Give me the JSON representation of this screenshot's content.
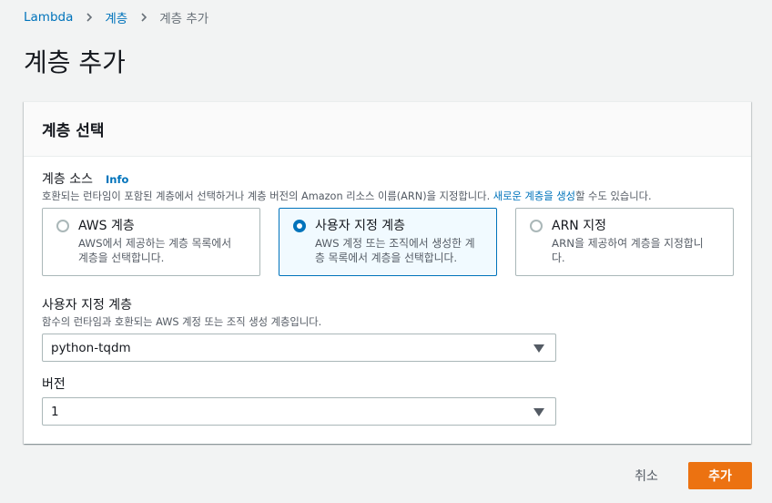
{
  "breadcrumb": {
    "items": [
      "Lambda",
      "계층",
      "계층 추가"
    ]
  },
  "page": {
    "title": "계층 추가"
  },
  "panel": {
    "title": "계층 선택",
    "source": {
      "label": "계층 소스",
      "info": "Info",
      "description_prefix": "호환되는 런타임이 포함된 계층에서 선택하거나 계층 버전의 Amazon 리소스 이름(ARN)을 지정합니다. ",
      "description_link": "새로운 계층을 생성",
      "description_suffix": "할 수도 있습니다.",
      "options": [
        {
          "title": "AWS 계층",
          "description": "AWS에서 제공하는 계층 목록에서 계층을 선택합니다.",
          "selected": false
        },
        {
          "title": "사용자 지정 계층",
          "description": "AWS 계정 또는 조직에서 생성한 계층 목록에서 계층을 선택합니다.",
          "selected": true
        },
        {
          "title": "ARN 지정",
          "description": "ARN을 제공하여 계층을 지정합니다.",
          "selected": false
        }
      ]
    },
    "custom_layer": {
      "label": "사용자 지정 계층",
      "description": "함수의 런타임과 호환되는 AWS 계정 또는 조직 생성 계층입니다.",
      "value": "python-tqdm"
    },
    "version": {
      "label": "버전",
      "value": "1"
    }
  },
  "actions": {
    "cancel": "취소",
    "add": "추가"
  },
  "colors": {
    "accent": "#0073bb",
    "primary_button": "#ec7211",
    "background": "#f2f3f3"
  }
}
